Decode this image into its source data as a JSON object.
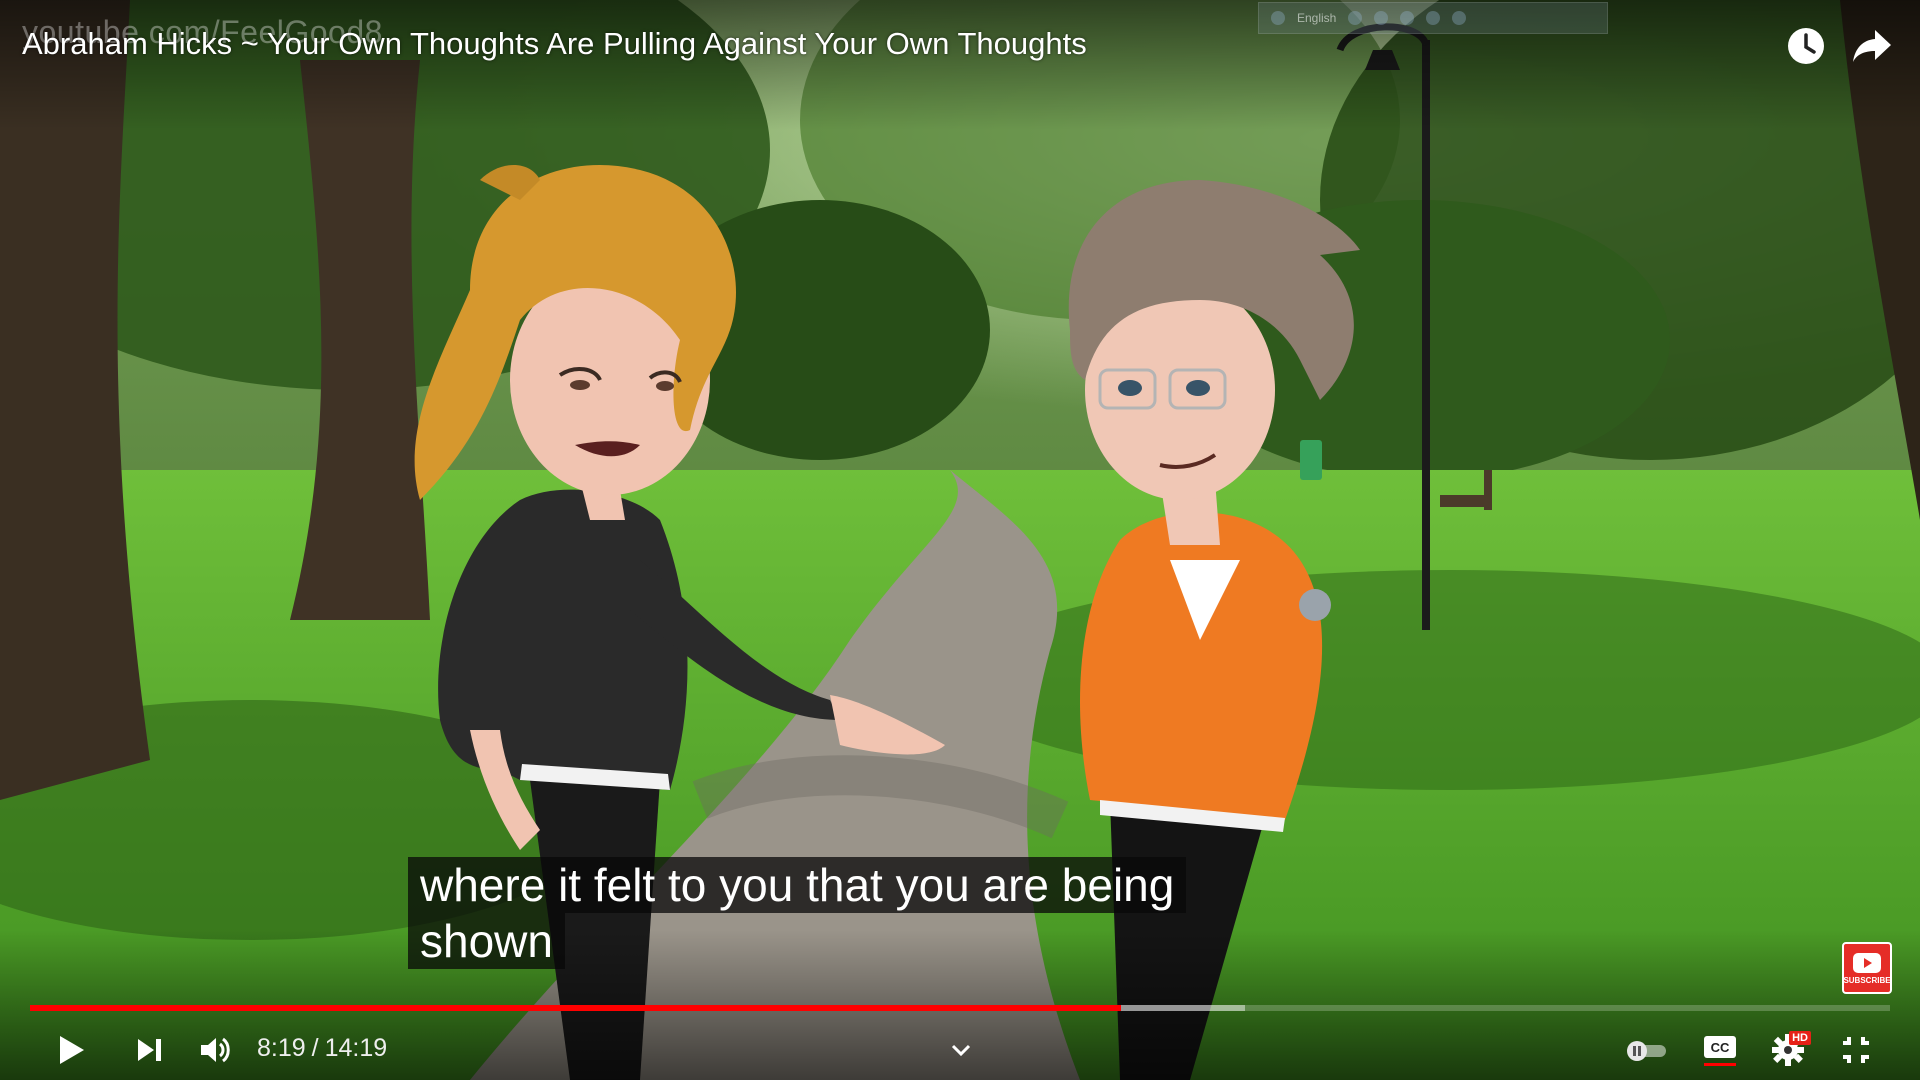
{
  "watermark": "youtube.com/FeelGood8",
  "video": {
    "title": "Abraham Hicks ~ Your Own Thoughts Are Pulling Against Your Own Thoughts",
    "caption_lines": [
      "where it felt to you that you are being",
      "shown"
    ]
  },
  "toolbar": {
    "language": "English"
  },
  "player": {
    "current_time": "8:19",
    "separator": "/",
    "duration": "14:19",
    "progress_played_fraction": 0.5867,
    "progress_buffered_fraction": 0.6533,
    "quality_badge": "HD",
    "subscribe_label": "SUBSCRIBE"
  },
  "icons": {
    "watch_later": "clock-icon",
    "share": "share-arrow-icon",
    "play": "play-icon",
    "next": "skip-next-icon",
    "volume": "volume-icon",
    "chapters": "chevron-down-icon",
    "autoplay": "autoplay-toggle-icon",
    "captions": "closed-captions-icon",
    "settings": "gear-icon",
    "exit_fullscreen": "exit-fullscreen-icon"
  },
  "colors": {
    "progress": "#ff0000",
    "accent": "#ff0000"
  }
}
